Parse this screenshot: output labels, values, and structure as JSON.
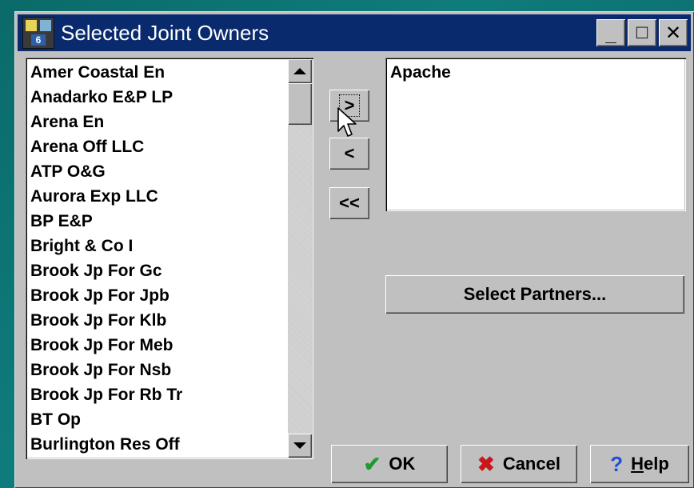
{
  "window": {
    "title": "Selected Joint Owners",
    "caption_buttons": {
      "minimize": "_",
      "maximize": "□",
      "close": "✕"
    }
  },
  "available_list": {
    "items": [
      "Amer Coastal En",
      "Anadarko E&P LP",
      "Arena En",
      "Arena Off LLC",
      "ATP O&G",
      "Aurora Exp LLC",
      "BP E&P",
      "Bright & Co I",
      "Brook Jp For Gc",
      "Brook Jp For Jpb",
      "Brook Jp For Klb",
      "Brook Jp For Meb",
      "Brook Jp For Nsb",
      "Brook Jp For Rb Tr",
      "BT Op",
      "Burlington Res Off"
    ]
  },
  "move_buttons": {
    "add": ">",
    "remove": "<",
    "remove_all": "<<"
  },
  "selected_list": {
    "items": [
      "Apache"
    ]
  },
  "select_partners_label": "Select Partners...",
  "footer": {
    "ok_label": "OK",
    "cancel_label": "Cancel",
    "help_label_underlined": "H",
    "help_label_rest": "elp"
  },
  "icons": {
    "ok": "check-icon",
    "cancel": "x-icon",
    "help": "question-icon",
    "app": "app-icon"
  },
  "colors": {
    "titlebar": "#0a2a6e",
    "face": "#c0c0c0",
    "desktop": "#0f7c7c",
    "ok_check": "#1e9a2e",
    "cancel_x": "#c8161d",
    "help_q": "#1d4fd8"
  }
}
